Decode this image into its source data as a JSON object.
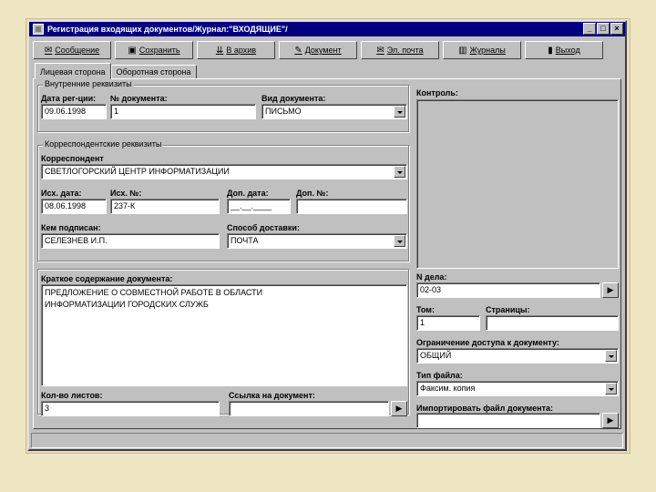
{
  "window": {
    "title": "Регистрация входящих документов/Журнал:\"ВХОДЯЩИЕ\"/",
    "minimize": "_",
    "maximize": "□",
    "close": "×"
  },
  "toolbar": [
    {
      "label": "Сообщение",
      "icon": "✉"
    },
    {
      "label": "Сохранить",
      "icon": "▣"
    },
    {
      "label": "В архив",
      "icon": "⇊"
    },
    {
      "label": "Документ",
      "icon": "✎"
    },
    {
      "label": "Эл. почта",
      "icon": "✉"
    },
    {
      "label": "Журналы",
      "icon": "▥"
    },
    {
      "label": "Выход",
      "icon": "▮"
    }
  ],
  "tabs": [
    "Лицевая сторона",
    "Оборотная сторона"
  ],
  "internal": {
    "group_title": "Внутренние реквизиты",
    "reg_date_label": "Дата рег-ции:",
    "reg_date": "09.06.1998",
    "doc_num_label": "№ документа:",
    "doc_num": "1",
    "doc_type_label": "Вид документа:",
    "doc_type": "ПИСЬМО"
  },
  "correspondent": {
    "group_title": "Корреспондентские реквизиты",
    "correspondent_label": "Корреспондент",
    "correspondent": "СВЕТЛОГОРСКИЙ ЦЕНТР ИНФОРМАТИЗАЦИИ",
    "out_date_label": "Исх. дата:",
    "out_date": "08.06.1998",
    "out_num_label": "Исх. №:",
    "out_num": "237-К",
    "add_date_label": "Доп. дата:",
    "add_date": "__.__.____",
    "add_num_label": "Доп. №:",
    "add_num": "",
    "signed_label": "Кем подписан:",
    "signed": "СЕЛЕЗНЕВ И.П.",
    "delivery_label": "Способ доставки:",
    "delivery": "ПОЧТА"
  },
  "summary": {
    "label": "Краткое содержание документа:",
    "line1": "ПРЕДЛОЖЕНИЕ О СОВМЕСТНОЙ РАБОТЕ В ОБЛАСТИ",
    "line2": "ИНФОРМАТИЗАЦИИ ГОРОДСКИХ СЛУЖБ"
  },
  "sheets": {
    "label": "Кол-во листов:",
    "value": "3"
  },
  "doc_link": {
    "label": "Ссылка на документ:",
    "value": ""
  },
  "control": {
    "label": "Контроль:"
  },
  "case_num": {
    "label": "N дела:",
    "value": "02-03"
  },
  "volume": {
    "label": "Том:",
    "value": "1"
  },
  "pages": {
    "label": "Страницы:",
    "value": ""
  },
  "access": {
    "label": "Ограничение доступа к документу:",
    "value": "ОБЩИЙ"
  },
  "file_type": {
    "label": "Тип файла:",
    "value": "Факсим. копия"
  },
  "import_file": {
    "label": "Импортировать файл документа:",
    "value": ""
  },
  "browse_glyph": "▶"
}
